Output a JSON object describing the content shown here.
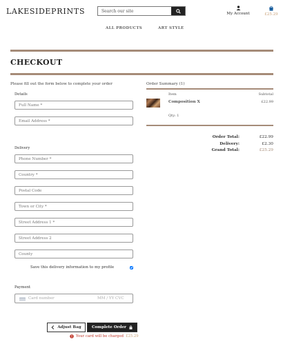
{
  "header": {
    "logo_bold": "LAKESIDE",
    "logo_thin": "PRINTS",
    "search_placeholder": "Search our site",
    "account_label": "My Account",
    "cart_total": "£25.29"
  },
  "nav": {
    "items": [
      "ALL PRODUCTS",
      "ART STYLE"
    ]
  },
  "page": {
    "title": "CHECKOUT",
    "intro": "Please fill out the form below to complete your order"
  },
  "details": {
    "label": "Details",
    "full_name_placeholder": "Full Name *",
    "email_placeholder": "Email Address *"
  },
  "delivery": {
    "label": "Delivery",
    "phone_placeholder": "Phone Number *",
    "country_placeholder": "Country *",
    "postal_placeholder": "Postal Code",
    "town_placeholder": "Town or City *",
    "street1_placeholder": "Street Address 1 *",
    "street2_placeholder": "Street Address 2",
    "county_placeholder": "County",
    "save_info_label": "Save this delivery information to my profile",
    "save_info_checked": true
  },
  "payment": {
    "label": "Payment",
    "card_placeholder": "Card number",
    "expiry_placeholder": "MM / YY  CVC"
  },
  "actions": {
    "adjust_label": "Adjust Bag",
    "complete_label": "Complete Order",
    "charge_prefix": "Your card will be charged",
    "charge_amount": "£25.29"
  },
  "summary": {
    "title": "Order Summary (1)",
    "col_item": "Item",
    "col_subtotal": "Subtotal",
    "product_name": "Composition X",
    "product_price": "£22.99",
    "product_qty": "Qty: 1",
    "order_total_label": "Order Total:",
    "order_total_value": "£22.99",
    "delivery_label": "Delivery:",
    "delivery_value": "£2.30",
    "grand_total_label": "Grand Total:",
    "grand_total_value": "£25.29"
  },
  "colors": {
    "accent": "#a58b78",
    "gold": "#c9a27a",
    "error": "#c0392b",
    "dark": "#222222"
  }
}
